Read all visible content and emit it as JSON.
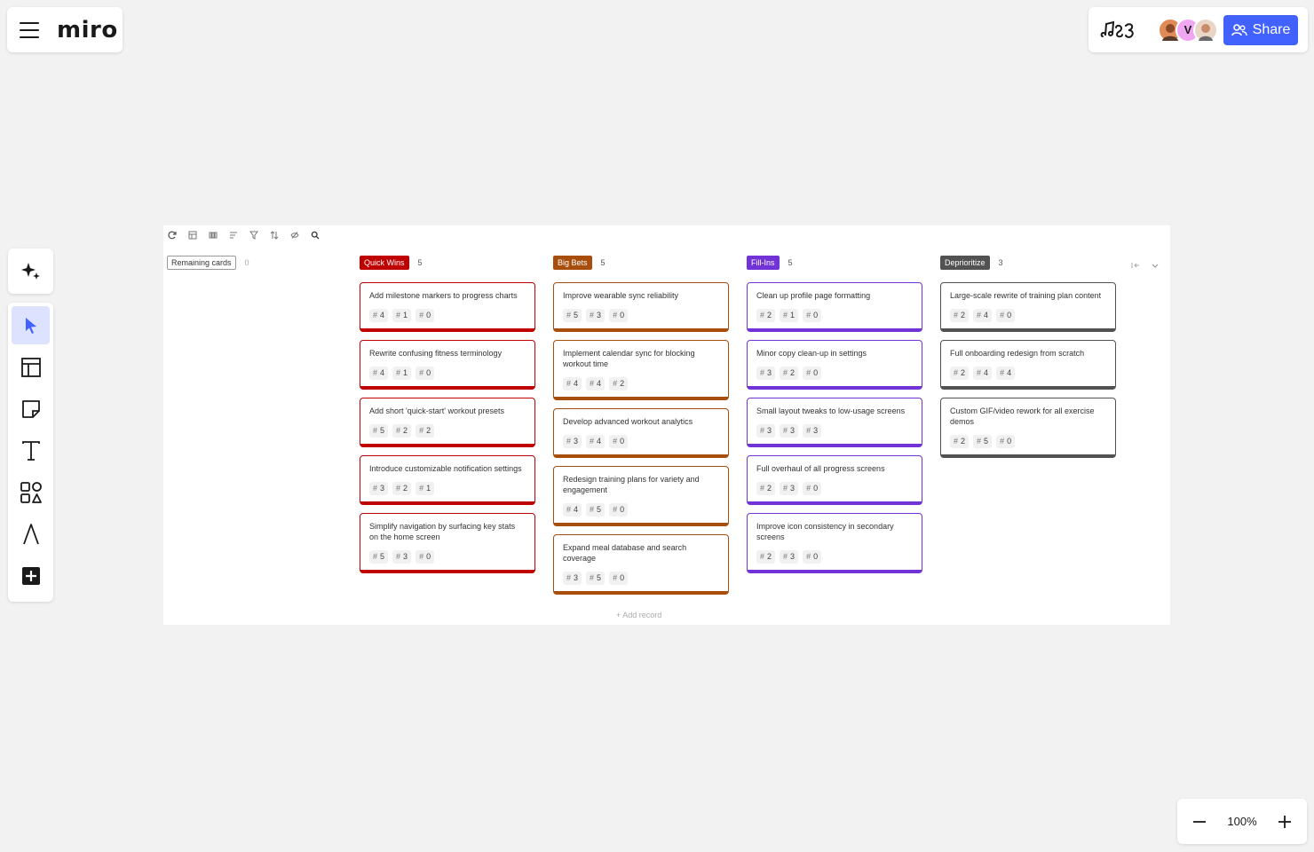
{
  "app": {
    "brand": "miro"
  },
  "header": {
    "share_label": "Share",
    "avatars": [
      {
        "letter": "",
        "color": "#e08a55"
      },
      {
        "letter": "V",
        "color": "#f0a6f0"
      },
      {
        "letter": "",
        "color": "#c98b6c"
      }
    ]
  },
  "zoom": {
    "level": "100%"
  },
  "board": {
    "remaining_label": "Remaining cards",
    "remaining_count": "0",
    "add_record": "+ Add record",
    "columns": [
      {
        "name": "Quick Wins",
        "count": "5",
        "color": "#c00000",
        "cards": [
          {
            "title": "Add milestone markers to progress charts",
            "badges": [
              "4",
              "1",
              "0"
            ]
          },
          {
            "title": "Rewrite confusing fitness terminology",
            "badges": [
              "4",
              "1",
              "0"
            ]
          },
          {
            "title": "Add short 'quick-start' workout presets",
            "badges": [
              "5",
              "2",
              "2"
            ]
          },
          {
            "title": "Introduce customizable notification settings",
            "badges": [
              "3",
              "2",
              "1"
            ]
          },
          {
            "title": "Simplify navigation by surfacing key stats on the home screen",
            "badges": [
              "5",
              "3",
              "0"
            ]
          }
        ]
      },
      {
        "name": "Big Bets",
        "count": "5",
        "color": "#a84e0c",
        "cards": [
          {
            "title": "Improve wearable sync reliability",
            "badges": [
              "5",
              "3",
              "0"
            ]
          },
          {
            "title": "Implement calendar sync for blocking workout time",
            "badges": [
              "4",
              "4",
              "2"
            ]
          },
          {
            "title": "Develop advanced workout analytics",
            "badges": [
              "3",
              "4",
              "0"
            ]
          },
          {
            "title": "Redesign training plans for variety and engagement",
            "badges": [
              "4",
              "5",
              "0"
            ]
          },
          {
            "title": "Expand meal database and search coverage",
            "badges": [
              "3",
              "5",
              "0"
            ]
          }
        ]
      },
      {
        "name": "Fill-Ins",
        "count": "5",
        "color": "#7233d6",
        "cards": [
          {
            "title": "Clean up profile page formatting",
            "badges": [
              "2",
              "1",
              "0"
            ]
          },
          {
            "title": "Minor copy clean-up in settings",
            "badges": [
              "3",
              "2",
              "0"
            ]
          },
          {
            "title": "Small layout tweaks to low-usage screens",
            "badges": [
              "3",
              "3",
              "3"
            ]
          },
          {
            "title": "Full overhaul of all progress screens",
            "badges": [
              "2",
              "3",
              "0"
            ]
          },
          {
            "title": "Improve icon consistency in secondary screens",
            "badges": [
              "2",
              "3",
              "0"
            ]
          }
        ]
      },
      {
        "name": "Deprioritize",
        "count": "3",
        "color": "#525252",
        "cards": [
          {
            "title": "Large-scale rewrite of training plan content",
            "badges": [
              "2",
              "4",
              "0"
            ]
          },
          {
            "title": "Full onboarding redesign from scratch",
            "badges": [
              "2",
              "4",
              "4"
            ]
          },
          {
            "title": "Custom GIF/video rework for all exercise demos",
            "badges": [
              "2",
              "5",
              "0"
            ]
          }
        ]
      }
    ]
  }
}
